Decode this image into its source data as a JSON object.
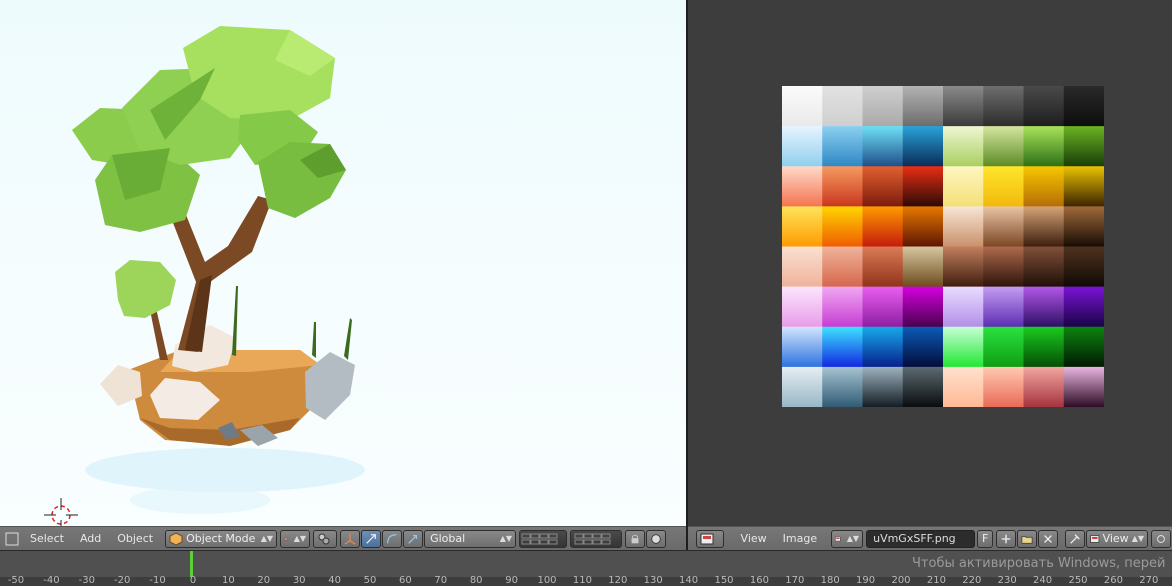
{
  "view3d": {
    "menu": [
      "Select",
      "Add",
      "Object"
    ],
    "mode": "Object Mode",
    "orientation": "Global"
  },
  "image_editor": {
    "menu": [
      "View",
      "Image"
    ],
    "image_name": "uVmGxSFF.png",
    "fake_user": "F",
    "view_label": "View"
  },
  "timeline": {
    "ticks": [
      -50,
      -40,
      -30,
      -20,
      -10,
      0,
      10,
      20,
      30,
      40,
      50,
      60,
      70,
      80,
      90,
      100,
      110,
      120,
      130,
      140,
      150,
      160,
      170,
      180,
      190,
      200,
      210,
      220,
      230,
      240,
      250,
      260,
      270
    ],
    "current_frame": 0
  },
  "watermark": "Чтобы активировать Windows, перей",
  "palette": {
    "rows": [
      [
        [
          "#fbfbfb",
          "#e9e9e9"
        ],
        [
          "#e2e2e2",
          "#cfcfcf"
        ],
        [
          "#cfcfcf",
          "#a9a9a9"
        ],
        [
          "#b3b3b3",
          "#6c6c6c"
        ],
        [
          "#8a8a8a",
          "#3a3a3a"
        ],
        [
          "#6e6e6e",
          "#2c2c2c"
        ],
        [
          "#4a4a4a",
          "#1d1d1d"
        ],
        [
          "#2a2a2a",
          "#0c0c0c"
        ]
      ],
      [
        [
          "#e7f4ff",
          "#8fcfee"
        ],
        [
          "#8cd0f0",
          "#2d86c4"
        ],
        [
          "#6ee0f5",
          "#1e4e8a"
        ],
        [
          "#2aa2d9",
          "#092b55"
        ],
        [
          "#f0f6d2",
          "#a8cf5f"
        ],
        [
          "#d4e6a0",
          "#5c8a24"
        ],
        [
          "#a8e35a",
          "#2d6e16"
        ],
        [
          "#6bb324",
          "#173d07"
        ]
      ],
      [
        [
          "#ffd9c9",
          "#f4734f"
        ],
        [
          "#f59a5f",
          "#c9351e"
        ],
        [
          "#e2602f",
          "#7a1b0c"
        ],
        [
          "#e92e14",
          "#2b0a06"
        ],
        [
          "#fff6c2",
          "#f2e074"
        ],
        [
          "#ffe62d",
          "#f2b80b"
        ],
        [
          "#f7c700",
          "#b46d07"
        ],
        [
          "#eac300",
          "#3a2200"
        ]
      ],
      [
        [
          "#ffe45a",
          "#ff9a00"
        ],
        [
          "#ffd500",
          "#f05a00"
        ],
        [
          "#ff9a00",
          "#c41a0c"
        ],
        [
          "#e77700",
          "#5d1502"
        ],
        [
          "#f7e6d6",
          "#c9906a"
        ],
        [
          "#e9c5a6",
          "#7a4523"
        ],
        [
          "#d6a477",
          "#3a1c0c"
        ],
        [
          "#a06a3a",
          "#160b04"
        ]
      ],
      [
        [
          "#fbe0d2",
          "#efb29a"
        ],
        [
          "#efb49a",
          "#d5664c"
        ],
        [
          "#da7c56",
          "#8f3218"
        ],
        [
          "#d7c7a0",
          "#6d4a1c"
        ],
        [
          "#c1805f",
          "#3f1c0e"
        ],
        [
          "#ad6a4c",
          "#2d130a"
        ],
        [
          "#80503a",
          "#1e0e07"
        ],
        [
          "#4f321f",
          "#0f0904"
        ]
      ],
      [
        [
          "#fce6fc",
          "#e89be8"
        ],
        [
          "#f0a8f3",
          "#c53bd1"
        ],
        [
          "#e95ef0",
          "#8c1ea0"
        ],
        [
          "#d400df",
          "#48004d"
        ],
        [
          "#eadcff",
          "#b28ee8"
        ],
        [
          "#c59cf2",
          "#5c2cb2"
        ],
        [
          "#b257e8",
          "#2c0f65"
        ],
        [
          "#7a14d6",
          "#180245"
        ]
      ],
      [
        [
          "#d3e6ff",
          "#2b71de"
        ],
        [
          "#3de3ff",
          "#1226e0"
        ],
        [
          "#17a9ea",
          "#081f8c"
        ],
        [
          "#0d5ab6",
          "#020c3a"
        ],
        [
          "#c9ffd6",
          "#1fe832"
        ],
        [
          "#2ae240",
          "#0f9c12"
        ],
        [
          "#1acb1f",
          "#044d05"
        ],
        [
          "#0c8510",
          "#011801"
        ]
      ],
      [
        [
          "#e6eef2",
          "#98b6c6"
        ],
        [
          "#a6c3d1",
          "#2f5a73"
        ],
        [
          "#9eb3bf",
          "#121b22"
        ],
        [
          "#5c6a72",
          "#080b0d"
        ],
        [
          "#ffe2ce",
          "#ffb895"
        ],
        [
          "#ffc9b2",
          "#e96a55"
        ],
        [
          "#f1a6a0",
          "#a4323e"
        ],
        [
          "#e8b5e0",
          "#2c0a22"
        ]
      ]
    ]
  }
}
